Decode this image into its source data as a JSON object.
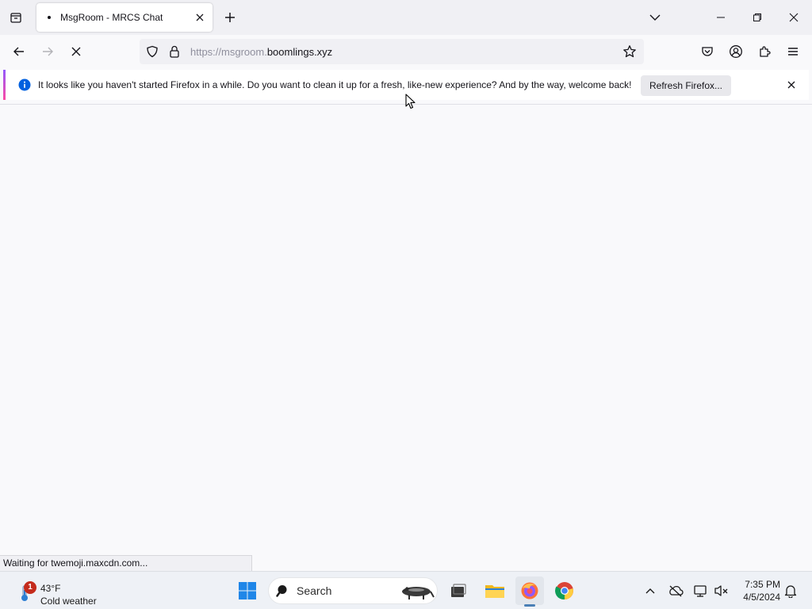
{
  "browser": {
    "tab": {
      "title": "MsgRoom - MRCS Chat"
    },
    "url": {
      "scheme": "https://msgroom.",
      "host": "boomlings.xyz"
    },
    "notification": {
      "message": "It looks like you haven't started Firefox in a while. Do you want to clean it up for a fresh, like-new experience? And by the way, welcome back!",
      "button_label": "Refresh Firefox..."
    },
    "status_text": "Waiting for twemoji.maxcdn.com..."
  },
  "taskbar": {
    "weather": {
      "temp": "43°F",
      "condition": "Cold weather",
      "badge": "1"
    },
    "search_label": "Search",
    "clock": {
      "time": "7:35 PM",
      "date": "4/5/2024"
    }
  },
  "colors": {
    "accent": "#0060df",
    "notification_gradient": [
      "#9059ff",
      "#ff4aa2"
    ],
    "badge": "#c42b1c"
  },
  "icons": [
    "tab-list-icon",
    "page-loading-icon",
    "tab-close-icon",
    "new-tab-icon",
    "tabs-dropdown-icon",
    "minimize-icon",
    "restore-icon",
    "window-close-icon",
    "back-icon",
    "forward-icon",
    "stop-icon",
    "shield-icon",
    "lock-icon",
    "bookmark-star-icon",
    "pocket-icon",
    "account-icon",
    "extensions-icon",
    "menu-icon",
    "info-icon",
    "notification-close-icon",
    "weather-icon",
    "windows-start-icon",
    "search-icon",
    "task-view-icon",
    "file-explorer-icon",
    "firefox-icon",
    "chrome-icon",
    "chevron-up-icon",
    "onedrive-icon",
    "network-icon",
    "volume-icon",
    "notification-bell-icon",
    "mouse-cursor-icon"
  ]
}
